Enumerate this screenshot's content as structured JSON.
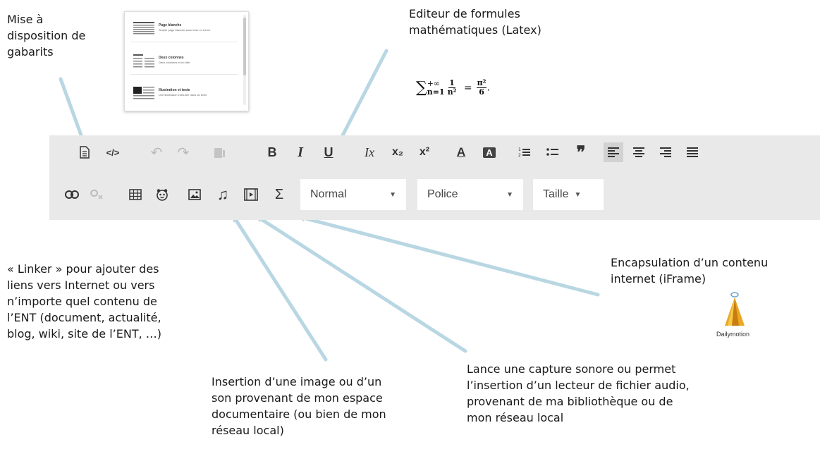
{
  "annotations": {
    "templates": "Mise à\ndisposition de\ngabarits",
    "formula_editor": "Editeur de formules\nmathématiques (Latex)",
    "linker": "« Linker » pour ajouter des\nliens vers Internet ou vers\nn’importe quel contenu de\nl’ENT (document, actualité,\nblog, wiki, site de l’ENT, …)",
    "image_insert": "Insertion d’une image ou d’un\nson provenant de mon espace\ndocumentaire (ou bien de mon\nréseau local)",
    "audio": "Lance une capture sonore ou permet\nl’insertion d’un lecteur de fichier audio,\nprovenant de ma bibliothèque ou de\nmon réseau local",
    "iframe": "Encapsulation d’un contenu\ninternet (iFrame)"
  },
  "template_preview": {
    "items": [
      {
        "title": "Page blanche",
        "desc": "Simple page blanche sans mise en forme"
      },
      {
        "title": "Deux colonnes",
        "desc": "Deux colonnes et un titre."
      },
      {
        "title": "Illustration et texte",
        "desc": "Une illustration entourée dans du texte"
      }
    ]
  },
  "formula": {
    "sum_symbol": "∑",
    "upper": "+∞",
    "lower": "n=1",
    "numerator": "1",
    "denominator": "n²",
    "equals": "=",
    "rhs_numerator": "π²",
    "rhs_denominator": "6",
    "period": "."
  },
  "toolbar": {
    "row1": [
      {
        "name": "templates-icon",
        "glyph": "🗎"
      },
      {
        "name": "source-icon",
        "glyph": "</>"
      },
      {
        "name": "undo-icon",
        "glyph": "↶"
      },
      {
        "name": "redo-icon",
        "glyph": "↷"
      },
      {
        "name": "paste-icon",
        "glyph": "📋"
      },
      {
        "name": "bold-icon",
        "glyph": "B"
      },
      {
        "name": "italic-icon",
        "glyph": "I"
      },
      {
        "name": "underline-icon",
        "glyph": "U"
      },
      {
        "name": "remove-format-icon",
        "glyph": "Ix"
      },
      {
        "name": "subscript-icon",
        "glyph": "x₂"
      },
      {
        "name": "superscript-icon",
        "glyph": "x²"
      },
      {
        "name": "text-color-icon",
        "glyph": "A"
      },
      {
        "name": "background-color-icon",
        "glyph": "A"
      },
      {
        "name": "numbered-list-icon",
        "glyph": "⒈"
      },
      {
        "name": "bullet-list-icon",
        "glyph": "⁝"
      },
      {
        "name": "blockquote-icon",
        "glyph": "❞"
      },
      {
        "name": "align-left-icon",
        "glyph": "≡"
      },
      {
        "name": "align-center-icon",
        "glyph": "≡"
      },
      {
        "name": "align-right-icon",
        "glyph": "≡"
      },
      {
        "name": "justify-icon",
        "glyph": "≡"
      }
    ],
    "row2": [
      {
        "name": "link-icon",
        "glyph": "🔗"
      },
      {
        "name": "unlink-icon",
        "glyph": "⛓"
      },
      {
        "name": "table-icon",
        "glyph": "▦"
      },
      {
        "name": "emoticon-icon",
        "glyph": "☺"
      },
      {
        "name": "image-icon",
        "glyph": "🖼"
      },
      {
        "name": "audio-icon",
        "glyph": "♫"
      },
      {
        "name": "iframe-icon",
        "glyph": "▶"
      },
      {
        "name": "formula-icon",
        "glyph": "Σ"
      }
    ],
    "format_select": "Normal",
    "font_select": "Police",
    "size_select": "Taille"
  },
  "dailymotion": {
    "label": "Dailymotion"
  }
}
